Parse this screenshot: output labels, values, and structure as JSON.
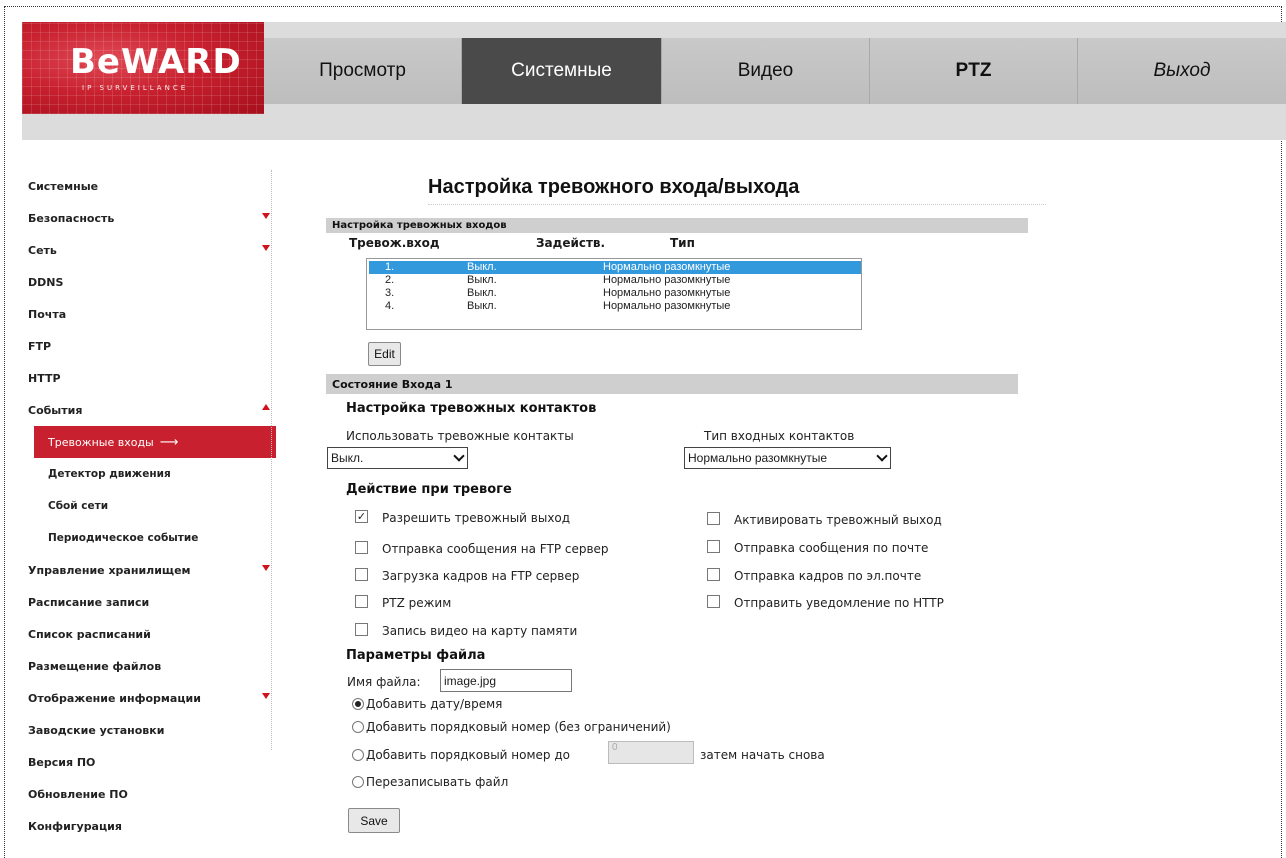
{
  "brand": {
    "logo_text": "BeWARD",
    "logo_sub": "IP SURVEILLANCE"
  },
  "nav": [
    {
      "label": "Просмотр"
    },
    {
      "label": "Системные"
    },
    {
      "label": "Видео"
    },
    {
      "label": "PTZ"
    },
    {
      "label": "Выход"
    }
  ],
  "sidebar": {
    "items": [
      {
        "label": "Системные"
      },
      {
        "label": "Безопасность"
      },
      {
        "label": "Сеть"
      },
      {
        "label": "DDNS"
      },
      {
        "label": "Почта"
      },
      {
        "label": "FTP"
      },
      {
        "label": "HTTP"
      },
      {
        "label": "События"
      },
      {
        "label": "Тревожные входы"
      },
      {
        "label": "Детектор движения"
      },
      {
        "label": "Сбой сети"
      },
      {
        "label": "Периодическое событие"
      },
      {
        "label": "Управление хранилищем"
      },
      {
        "label": "Расписание записи"
      },
      {
        "label": "Список расписаний"
      },
      {
        "label": "Размещение файлов"
      },
      {
        "label": "Отображение информации"
      },
      {
        "label": "Заводские установки"
      },
      {
        "label": "Версия ПО"
      },
      {
        "label": "Обновление ПО"
      },
      {
        "label": "Конфигурация"
      }
    ]
  },
  "page": {
    "title": "Настройка тревожного входа/выхода"
  },
  "inputs_section": {
    "title": "Настройка тревожных входов",
    "columns": [
      "Тревож.вход",
      "Задейств.",
      "Тип"
    ],
    "rows": [
      [
        "1.",
        "Выкл.",
        "Нормально разомкнутые"
      ],
      [
        "2.",
        "Выкл.",
        "Нормально разомкнутые"
      ],
      [
        "3.",
        "Выкл.",
        "Нормально разомкнутые"
      ],
      [
        "4.",
        "Выкл.",
        "Нормально разомкнутые"
      ]
    ],
    "edit_label": "Edit"
  },
  "state_section": {
    "title": "Состояние Входа 1",
    "contacts_heading": "Настройка тревожных контактов",
    "use_label": "Использовать тревожные контакты",
    "use_value": "Выкл.",
    "type_label": "Тип входных контактов",
    "type_value": "Нормально разомкнутые",
    "action_heading": "Действие при тревоге",
    "actions_left": [
      {
        "label": "Разрешить тревожный выход",
        "checked": true
      },
      {
        "label": "Отправка сообщения на FTP сервер",
        "checked": false
      },
      {
        "label": "Загрузка кадров на FTP сервер",
        "checked": false
      },
      {
        "label": "PTZ режим",
        "checked": false
      },
      {
        "label": "Запись видео на карту памяти",
        "checked": false
      }
    ],
    "actions_right": [
      {
        "label": "Активировать тревожный выход",
        "checked": false
      },
      {
        "label": "Отправка сообщения по почте",
        "checked": false
      },
      {
        "label": "Отправка кадров по эл.почте",
        "checked": false
      },
      {
        "label": "Отправить уведомление по HTTP",
        "checked": false
      }
    ],
    "file_heading": "Параметры файла",
    "filename_label": "Имя файла:",
    "filename_value": "image.jpg",
    "radio_options": [
      {
        "label": "Добавить дату/время",
        "selected": true
      },
      {
        "label": "Добавить порядковый номер (без ограничений)",
        "selected": false
      },
      {
        "label": "Добавить порядковый номер до",
        "selected": false
      },
      {
        "label": "Перезаписывать файл",
        "selected": false
      }
    ],
    "counter_value": "0",
    "counter_suffix": "затем начать снова",
    "save_label": "Save"
  }
}
